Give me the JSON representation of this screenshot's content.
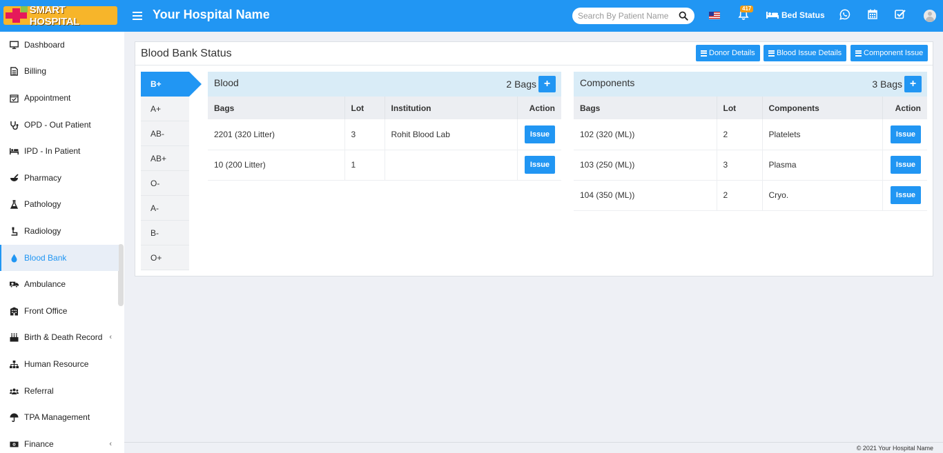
{
  "header": {
    "logo_text": "SMART HOSPITAL",
    "hospital_name": "Your Hospital Name",
    "search_placeholder": "Search By Patient Name",
    "notification_count": "417",
    "bed_status_label": "Bed Status"
  },
  "sidebar": {
    "items": [
      {
        "label": "Dashboard",
        "icon": "monitor-icon"
      },
      {
        "label": "Billing",
        "icon": "file-icon"
      },
      {
        "label": "Appointment",
        "icon": "calendar-check-icon"
      },
      {
        "label": "OPD - Out Patient",
        "icon": "stethoscope-icon"
      },
      {
        "label": "IPD - In Patient",
        "icon": "bed-icon"
      },
      {
        "label": "Pharmacy",
        "icon": "mortar-pestle-icon"
      },
      {
        "label": "Pathology",
        "icon": "flask-icon"
      },
      {
        "label": "Radiology",
        "icon": "xray-icon"
      },
      {
        "label": "Blood Bank",
        "icon": "blood-drop-icon"
      },
      {
        "label": "Ambulance",
        "icon": "ambulance-icon"
      },
      {
        "label": "Front Office",
        "icon": "building-icon"
      },
      {
        "label": "Birth & Death Record",
        "icon": "birthday-cake-icon"
      },
      {
        "label": "Human Resource",
        "icon": "sitemap-icon"
      },
      {
        "label": "Referral",
        "icon": "users-icon"
      },
      {
        "label": "TPA Management",
        "icon": "umbrella-icon"
      },
      {
        "label": "Finance",
        "icon": "money-icon"
      }
    ],
    "active_index": 8
  },
  "panel": {
    "title": "Blood Bank Status",
    "buttons": {
      "donor_details": "Donor Details",
      "blood_issue_details": "Blood Issue Details",
      "component_issue": "Component Issue"
    }
  },
  "blood_groups": [
    "B+",
    "A+",
    "AB-",
    "AB+",
    "O-",
    "A-",
    "B-",
    "O+"
  ],
  "blood_table": {
    "title": "Blood",
    "count": "2 Bags",
    "columns": [
      "Bags",
      "Lot",
      "Institution",
      "Action"
    ],
    "rows": [
      {
        "bags": "2201 (320 Litter)",
        "lot": "3",
        "institution": "Rohit Blood Lab",
        "action": "Issue"
      },
      {
        "bags": "10 (200 Litter)",
        "lot": "1",
        "institution": "",
        "action": "Issue"
      }
    ]
  },
  "components_table": {
    "title": "Components",
    "count": "3 Bags",
    "columns": [
      "Bags",
      "Lot",
      "Components",
      "Action"
    ],
    "rows": [
      {
        "bags": "102 (320 (ML))",
        "lot": "2",
        "component": "Platelets",
        "action": "Issue"
      },
      {
        "bags": "103 (250 (ML))",
        "lot": "3",
        "component": "Plasma",
        "action": "Issue"
      },
      {
        "bags": "104 (350 (ML))",
        "lot": "2",
        "component": "Cryo.",
        "action": "Issue"
      }
    ]
  },
  "footer": {
    "copyright": "© 2021 Your Hospital Name"
  },
  "colors": {
    "primary": "#2196f3",
    "header_bg": "#2196f3",
    "logo_bg": "#f7b52a",
    "table_head_bg": "#d9ecf7",
    "badge": "#f39c12"
  }
}
